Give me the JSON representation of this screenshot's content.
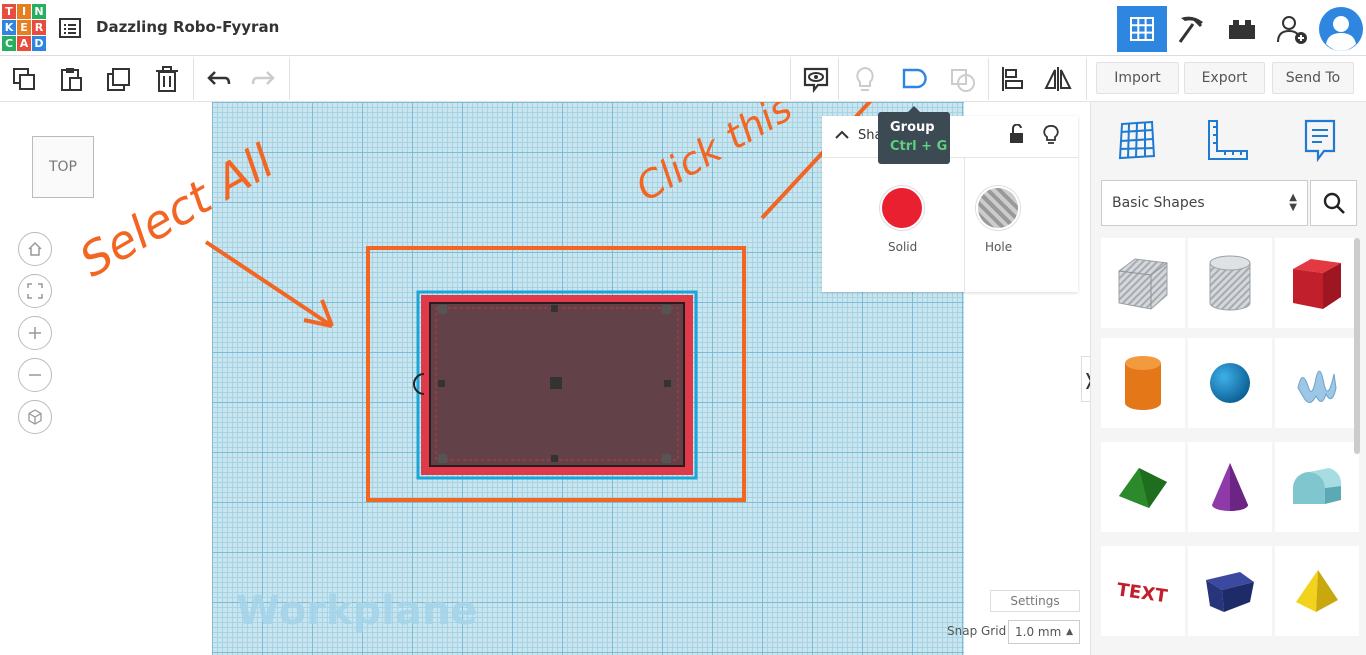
{
  "header": {
    "logo_letters": [
      "T",
      "I",
      "N",
      "K",
      "E",
      "R",
      "C",
      "A",
      "D"
    ],
    "project_title": "Dazzling Robo-Fyyran"
  },
  "toolbar": {
    "import_label": "Import",
    "export_label": "Export",
    "send_to_label": "Send To"
  },
  "canvas": {
    "view_cube_label": "TOP",
    "workplane_label": "Workplane"
  },
  "annotations": {
    "select_all": "Select All",
    "click_this": "Click this"
  },
  "shape_panel": {
    "title": "Shapes (2)",
    "solid_label": "Solid",
    "hole_label": "Hole",
    "solid_color": "#e8202f"
  },
  "tooltip": {
    "title": "Group",
    "shortcut": "Ctrl + G"
  },
  "bottom": {
    "settings_label": "Settings",
    "snap_grid_label": "Snap Grid",
    "snap_grid_value": "1.0 mm"
  },
  "right_panel": {
    "library_selected": "Basic Shapes"
  },
  "colors": {
    "accent": "#2e86e0",
    "annotation": "#f26522"
  }
}
